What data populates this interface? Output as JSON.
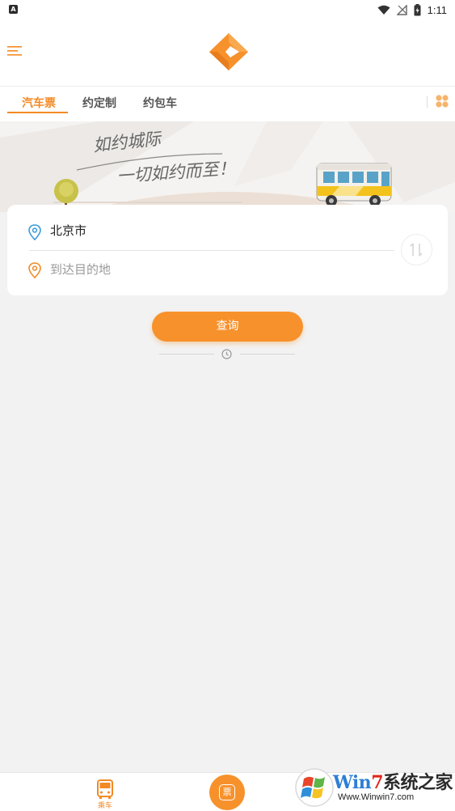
{
  "status_bar": {
    "time": "1:11",
    "notification_glyph": "A"
  },
  "header": {
    "menu_icon": "menu-icon",
    "logo_icon": "diamond-logo-icon"
  },
  "tabs": [
    {
      "label": "汽车票",
      "active": true
    },
    {
      "label": "约定制",
      "active": false
    },
    {
      "label": "约包车",
      "active": false
    }
  ],
  "banner": {
    "line1": "如约城际",
    "line2": "一切如约而至！"
  },
  "search": {
    "from_value": "北京市",
    "to_placeholder": "到达目的地",
    "query_label": "查询"
  },
  "bottom_nav": {
    "bus_label": "乘车",
    "ticket_glyph": "票"
  },
  "watermark": {
    "part_win": "Win",
    "part_7": "7",
    "part_rest": "系统之家",
    "url": "Www.Winwin7.com"
  },
  "colors": {
    "accent": "#f7912c",
    "accent_dark": "#f28a25",
    "pin_blue": "#3a9ad9"
  }
}
